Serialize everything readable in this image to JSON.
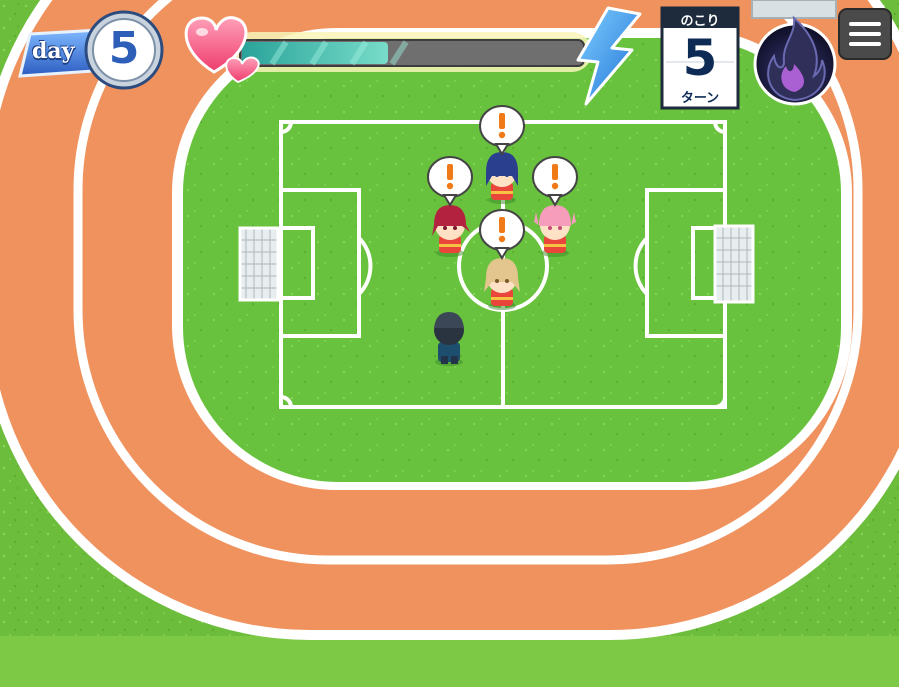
{
  "hud": {
    "day_label": "day",
    "day_number": "5",
    "affection_level": 0.43,
    "remaining_label": "のこり",
    "remaining_turns": "5",
    "remaining_unit": "ターン"
  },
  "icons": {
    "heart": "heart-icon",
    "energy": "lightning-icon",
    "spirit": "flame-icon",
    "menu": "hamburger-menu-icon",
    "alert": "exclamation-icon"
  },
  "colors": {
    "grass": "#6cbd3c",
    "field": "#69c23e",
    "track": "#f0925d",
    "line": "#ffffff",
    "affection_fill": "#49c2b3",
    "energy": "#2f8ff0"
  },
  "characters": [
    {
      "name": "blue-hair-girl",
      "alert": true
    },
    {
      "name": "red-hair-girl",
      "alert": true
    },
    {
      "name": "pink-hair-girl",
      "alert": true
    },
    {
      "name": "blonde-hair-girl",
      "alert": true
    },
    {
      "name": "player-boy",
      "alert": false
    }
  ]
}
